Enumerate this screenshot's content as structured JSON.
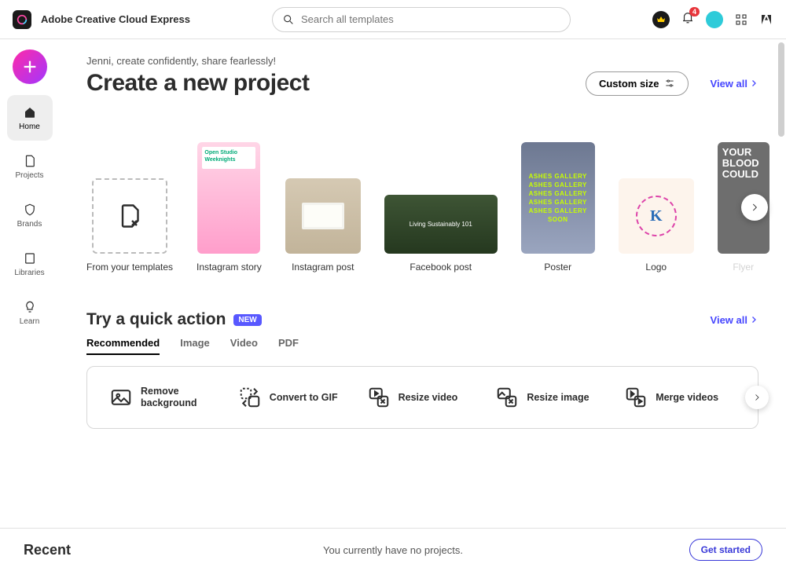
{
  "header": {
    "app_title": "Adobe Creative Cloud Express",
    "search_placeholder": "Search all templates",
    "notification_count": "4"
  },
  "sidebar": {
    "items": [
      {
        "label": "Home",
        "active": true
      },
      {
        "label": "Projects",
        "active": false
      },
      {
        "label": "Brands",
        "active": false
      },
      {
        "label": "Libraries",
        "active": false
      },
      {
        "label": "Learn",
        "active": false
      }
    ]
  },
  "create": {
    "greeting": "Jenni, create confidently, share fearlessly!",
    "title": "Create a new project",
    "custom_size_label": "Custom size",
    "view_all_label": "View all",
    "items": [
      {
        "label": "From your templates"
      },
      {
        "label": "Instagram story"
      },
      {
        "label": "Instagram post"
      },
      {
        "label": "Facebook post",
        "caption": "Living Sustainably 101"
      },
      {
        "label": "Poster",
        "lines": [
          "ASHES GALLERY",
          "ASHES GALLERY",
          "ASHES GALLERY",
          "ASHES GALLERY",
          "ASHES GALLERY",
          "SOON"
        ]
      },
      {
        "label": "Logo",
        "initial": "K"
      },
      {
        "label": "Flyer",
        "text": "YOUR BLOOD COULD"
      }
    ]
  },
  "quick_actions": {
    "title": "Try a quick action",
    "new_badge": "NEW",
    "view_all_label": "View all",
    "tabs": [
      "Recommended",
      "Image",
      "Video",
      "PDF"
    ],
    "active_tab": 0,
    "items": [
      {
        "label": "Remove background"
      },
      {
        "label": "Convert to GIF"
      },
      {
        "label": "Resize video"
      },
      {
        "label": "Resize image"
      },
      {
        "label": "Merge videos"
      }
    ]
  },
  "footer": {
    "title": "Recent",
    "message": "You currently have no projects.",
    "cta": "Get started"
  }
}
